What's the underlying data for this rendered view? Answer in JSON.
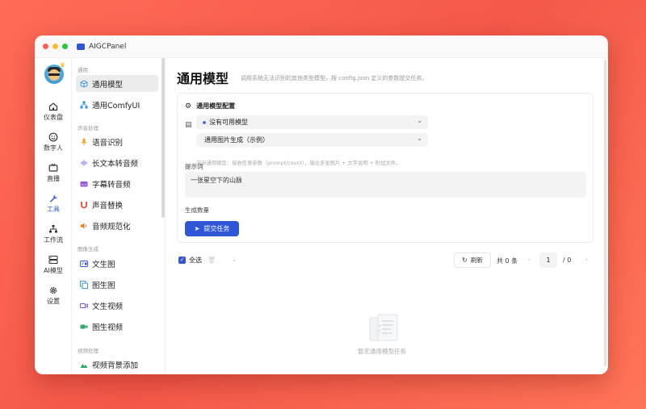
{
  "app": {
    "title": "AIGCPanel"
  },
  "rail": [
    {
      "label": "仪表盘",
      "icon": "home-icon"
    },
    {
      "label": "数字人",
      "icon": "smiley-icon"
    },
    {
      "label": "直播",
      "icon": "tv-icon"
    },
    {
      "label": "工具",
      "icon": "wrench-icon",
      "active": true
    },
    {
      "label": "工作流",
      "icon": "workflow-icon"
    },
    {
      "label": "AI模型",
      "icon": "server-icon"
    },
    {
      "label": "设置",
      "icon": "gear-icon"
    }
  ],
  "menu": {
    "groups": [
      {
        "title": "通用",
        "items": [
          {
            "label": "通用模型",
            "icon": "cube-icon",
            "active": true
          },
          {
            "label": "通用ComfyUI",
            "icon": "nodes-icon"
          }
        ]
      },
      {
        "title": "声音处理",
        "items": [
          {
            "label": "语音识别",
            "icon": "mic-icon"
          },
          {
            "label": "长文本转音频",
            "icon": "wave-icon"
          },
          {
            "label": "字幕转音频",
            "icon": "subtitle-icon"
          },
          {
            "label": "声音替换",
            "icon": "magnet-icon"
          },
          {
            "label": "音频规范化",
            "icon": "speaker-icon"
          }
        ]
      },
      {
        "title": "图像生成",
        "items": [
          {
            "label": "文生图",
            "icon": "text-image-icon"
          },
          {
            "label": "图生图",
            "icon": "image-image-icon"
          },
          {
            "label": "文生视频",
            "icon": "video-icon"
          },
          {
            "label": "图生视频",
            "icon": "image-video-icon"
          }
        ]
      },
      {
        "title": "视频处理",
        "items": [
          {
            "label": "视频背景添加",
            "icon": "landscape-icon"
          }
        ]
      }
    ]
  },
  "main": {
    "title": "通用模型",
    "description": "调用系统无法识别的其他类型模型，按 config.json 定义的参数提交任务。",
    "config": {
      "heading": "通用模型配置",
      "model_select": "没有可用模型",
      "function_select": "通用图片生成（示例）",
      "hint": "演示通用模型：接收任意参数（prompt/count），输出多张图片 + 文字说明 + 附加文件。",
      "prompt_label": "提示词",
      "prompt_value": "一张星空下的山脉",
      "count_label": "生成数量",
      "submit_label": "提交任务"
    },
    "toolbar": {
      "select_all": "全选",
      "refresh": "刷新",
      "total": "共 0 条",
      "page": "1",
      "page_total": "/ 0"
    },
    "empty_text": "暂无通用模型任务"
  },
  "colors": {
    "accent": "#2f56d6",
    "background": "#f4594a"
  }
}
